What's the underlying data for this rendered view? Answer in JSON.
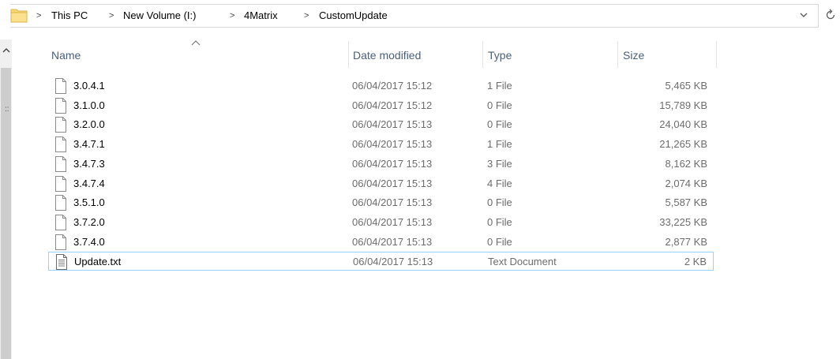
{
  "breadcrumb": {
    "items": [
      "This PC",
      "New Volume (I:)",
      "4Matrix",
      "CustomUpdate"
    ],
    "separator": ">"
  },
  "icons": {
    "folder": "folder-icon",
    "chevron": "chevron-down-icon",
    "refresh": "refresh-icon",
    "file": "file-icon",
    "text_file": "text-document-icon"
  },
  "columns": {
    "name": "Name",
    "date": "Date modified",
    "type": "Type",
    "size": "Size"
  },
  "nav_grip": "::",
  "files": [
    {
      "name": "3.0.4.1",
      "date": "06/04/2017 15:12",
      "type": "1 File",
      "size": "5,465 KB",
      "icon": "file-icon"
    },
    {
      "name": "3.1.0.0",
      "date": "06/04/2017 15:12",
      "type": "0 File",
      "size": "15,789 KB",
      "icon": "file-icon"
    },
    {
      "name": "3.2.0.0",
      "date": "06/04/2017 15:13",
      "type": "0 File",
      "size": "24,040 KB",
      "icon": "file-icon"
    },
    {
      "name": "3.4.7.1",
      "date": "06/04/2017 15:13",
      "type": "1 File",
      "size": "21,265 KB",
      "icon": "file-icon"
    },
    {
      "name": "3.4.7.3",
      "date": "06/04/2017 15:13",
      "type": "3 File",
      "size": "8,162 KB",
      "icon": "file-icon"
    },
    {
      "name": "3.4.7.4",
      "date": "06/04/2017 15:13",
      "type": "4 File",
      "size": "2,074 KB",
      "icon": "file-icon"
    },
    {
      "name": "3.5.1.0",
      "date": "06/04/2017 15:13",
      "type": "0 File",
      "size": "5,587 KB",
      "icon": "file-icon"
    },
    {
      "name": "3.7.2.0",
      "date": "06/04/2017 15:13",
      "type": "0 File",
      "size": "33,225 KB",
      "icon": "file-icon"
    },
    {
      "name": "3.7.4.0",
      "date": "06/04/2017 15:13",
      "type": "0 File",
      "size": "2,877 KB",
      "icon": "file-icon"
    },
    {
      "name": "Update.txt",
      "date": "06/04/2017 15:13",
      "type": "Text Document",
      "size": "2 KB",
      "icon": "text-document-icon",
      "selected": true
    }
  ],
  "colors": {
    "header_text": "#4c607a",
    "secondary_text": "#6d6d6d",
    "selection_border": "#99d1ff",
    "folder_yellow": "#f8d775"
  }
}
